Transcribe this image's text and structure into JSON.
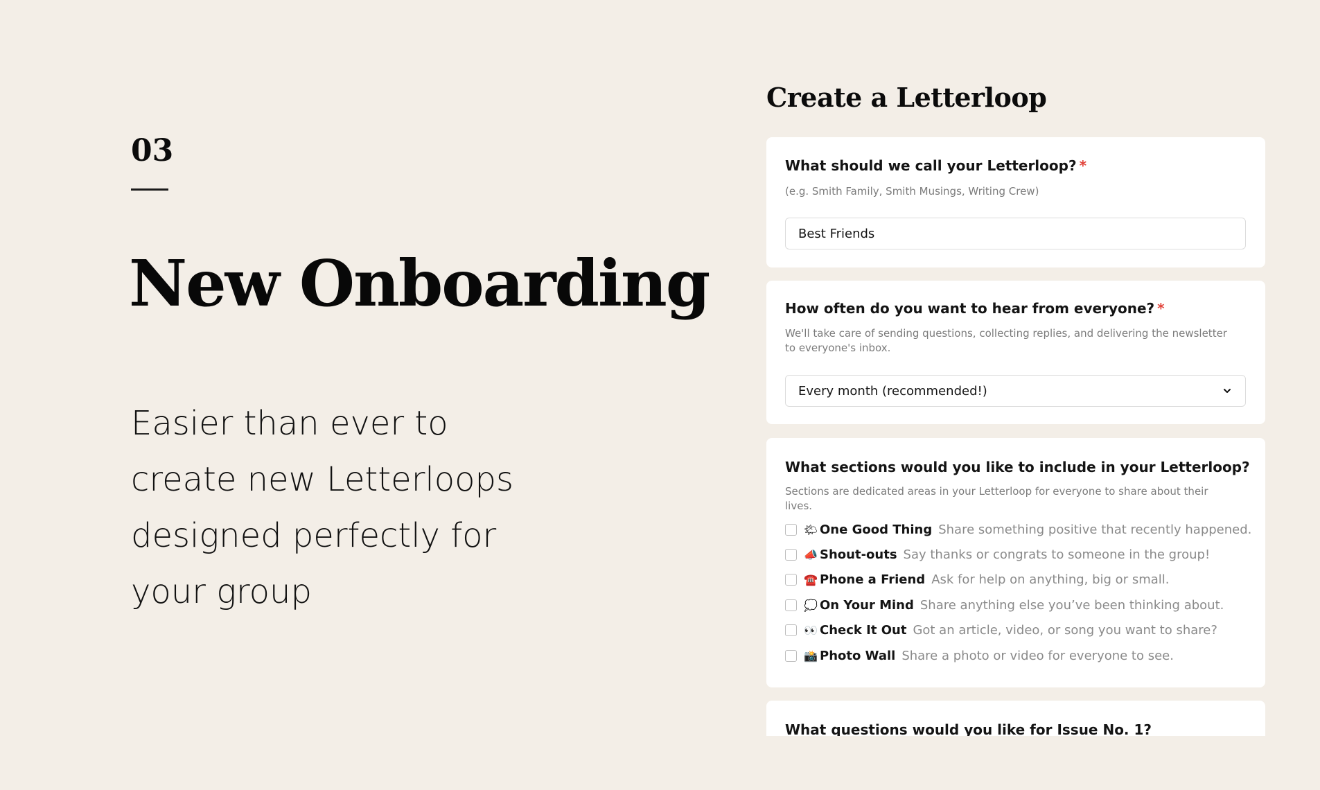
{
  "intro": {
    "step_number": "03",
    "headline": "New Onboarding",
    "tagline_lines": [
      "Easier than ever to",
      "create new Letterloops",
      "designed perfectly for",
      "your group"
    ]
  },
  "form": {
    "title": "Create a Letterloop",
    "name_card": {
      "question": "What should we call your Letterloop?",
      "required_mark": "*",
      "help": "(e.g. Smith Family, Smith Musings, Writing Crew)",
      "input_value": "Best Friends"
    },
    "frequency_card": {
      "question": "How often do you want to hear from everyone?",
      "required_mark": "*",
      "help": "We'll take care of sending questions, collecting replies, and delivering the newsletter to everyone's inbox.",
      "selected_value": "Every month (recommended!)"
    },
    "sections_card": {
      "question": "What sections would you like to include in your Letterloop?",
      "help": "Sections are dedicated areas in your Letterloop for everyone to share about their lives.",
      "options": [
        {
          "emoji": "🌤",
          "name": "One Good Thing",
          "desc": "Share something positive that recently happened.",
          "checked": false
        },
        {
          "emoji": "📣",
          "name": "Shout-outs",
          "desc": "Say thanks or congrats to someone in the group!",
          "checked": false
        },
        {
          "emoji": "☎️",
          "name": "Phone a Friend",
          "desc": "Ask for help on anything, big or small.",
          "checked": false
        },
        {
          "emoji": "💭",
          "name": "On Your Mind",
          "desc": "Share anything else you’ve been thinking about.",
          "checked": false
        },
        {
          "emoji": "👀",
          "name": "Check It Out",
          "desc": "Got an article, video, or song you want to share?",
          "checked": false
        },
        {
          "emoji": "📸",
          "name": "Photo Wall",
          "desc": "Share a photo or video for everyone to see.",
          "checked": false
        }
      ]
    },
    "questions_card": {
      "question": "What questions would you like for Issue No. 1?"
    }
  }
}
